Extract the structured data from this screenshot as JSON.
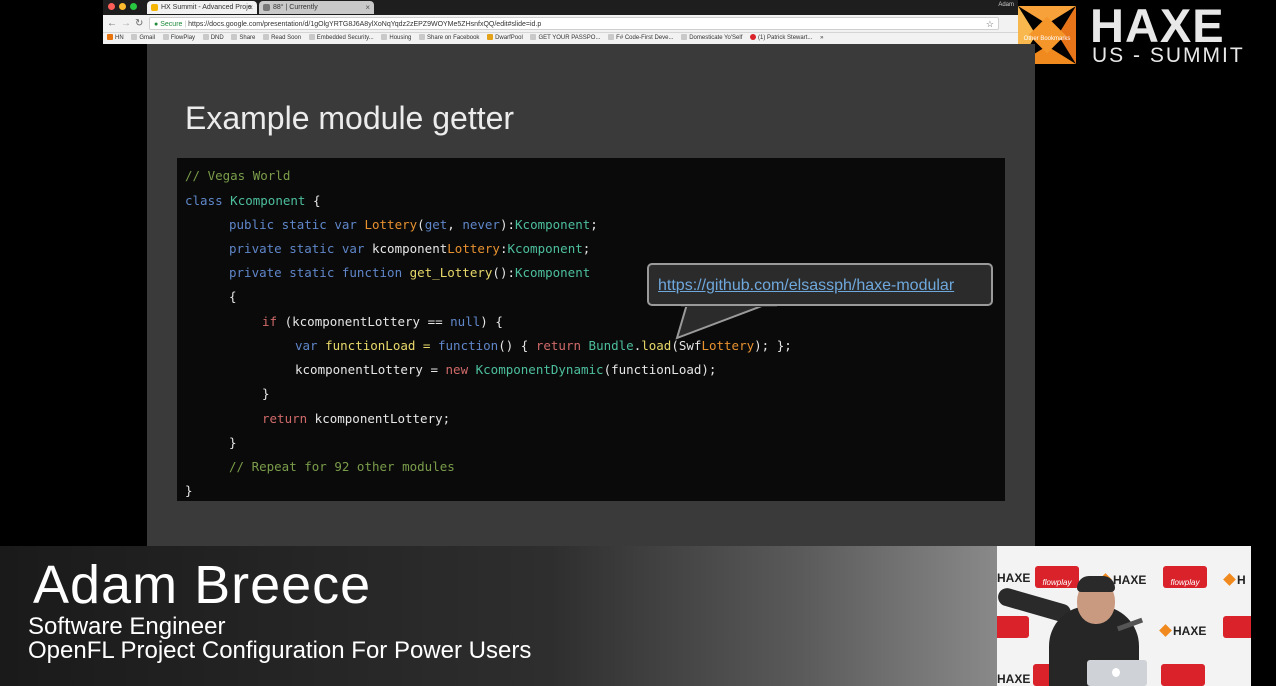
{
  "browser": {
    "tabs": [
      {
        "label": "HX Summit - Advanced Proje"
      },
      {
        "label": "88° | Currently"
      }
    ],
    "tab_close": "×",
    "nav": {
      "back": "←",
      "forward": "→",
      "reload": "↻"
    },
    "url": {
      "secure_label": "Secure",
      "separator": "|",
      "address": "https://docs.google.com/presentation/d/1gOlgYRTG8J6A8ylXoNqYqdz2zEPZ9WOYMe5ZHsnfxQQ/edit#slide=id.p"
    },
    "star": "☆",
    "bookmarks": [
      "HN",
      "Gmail",
      "FlowPlay",
      "DND",
      "Share",
      "Read Soon",
      "Embedded Security...",
      "Housing",
      "Share on Facebook",
      "DwarfPool",
      "GET YOUR PASSPO...",
      "F# Code-First Deve...",
      "Domesticate Yo'Self",
      "(1) Patrick Stewart..."
    ],
    "more_bookmarks": "»",
    "other_bookmarks": "Other Bookmarks",
    "user": "Adam"
  },
  "branding": {
    "name": "HAXE",
    "subtitle": "US - SUMMIT"
  },
  "slide": {
    "title": "Example module getter",
    "link": "https://github.com/elsassph/haxe-modular",
    "code": {
      "l1": "// Vegas World",
      "l2_kw": "class",
      "l2_ty": "Kcomponent",
      "l2_rest": " {",
      "l3_kw": "public static var",
      "l3_fn": "Lottery",
      "l3_p1": "(",
      "l3_get": "get",
      "l3_p2": ", ",
      "l3_never": "never",
      "l3_p3": "):",
      "l3_ty": "Kcomponent",
      "l3_end": ";",
      "l4_kw": "private static var",
      "l4_id": "kcomponent",
      "l4_or": "Lottery",
      "l4_p": ":",
      "l4_ty": "Kcomponent",
      "l4_end": ";",
      "l5_kw": "private static function",
      "l5_fn": "get_Lottery",
      "l5_p": "():",
      "l5_ty": "Kcomponent",
      "l6": "{",
      "l7_kw": "if",
      "l7_p1": " (kcomponentLottery == ",
      "l7_null": "null",
      "l7_p2": ") {",
      "l8_kw": "var",
      "l8_id": " functionLoad = ",
      "l8_fn": "function",
      "l8_p1": "() { ",
      "l8_ret": "return",
      "l8_ty": " Bundle",
      "l8_dot": ".",
      "l8_load": "load",
      "l8_p2": "(Swf",
      "l8_or": "Lottery",
      "l8_p3": "); };",
      "l9_id": "kcomponentLottery = ",
      "l9_new": "new",
      "l9_ty": " KcomponentDynamic",
      "l9_p": "(functionLoad);",
      "l10": "}",
      "l11_ret": "return",
      "l11_id": " kcomponentLottery;",
      "l12": "}",
      "l13": "// Repeat for 92 other modules",
      "l14": "}"
    }
  },
  "lower_third": {
    "name": "Adam Breece",
    "role": "Software Engineer",
    "talk": "OpenFL Project Configuration For Power Users"
  },
  "webcam": {
    "sponsor_haxe": "HAXE",
    "sponsor_flowplay": "flowplay"
  },
  "colors": {
    "haxe_orange": "#f08a1e",
    "flowplay_red": "#d9222a",
    "link_blue": "#6fa8dc"
  }
}
